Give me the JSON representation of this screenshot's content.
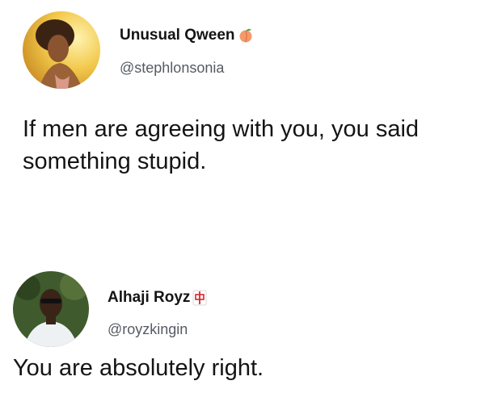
{
  "tweets": [
    {
      "display_name": "Unusual Qween",
      "handle": "@stephlonsonia",
      "name_emoji": "peach",
      "text": "If men are agreeing with you, you said something stupid."
    },
    {
      "display_name": "Alhaji Royz",
      "handle": "@royzkingin",
      "name_emoji": "red-symbol",
      "text": "You are absolutely right."
    }
  ]
}
